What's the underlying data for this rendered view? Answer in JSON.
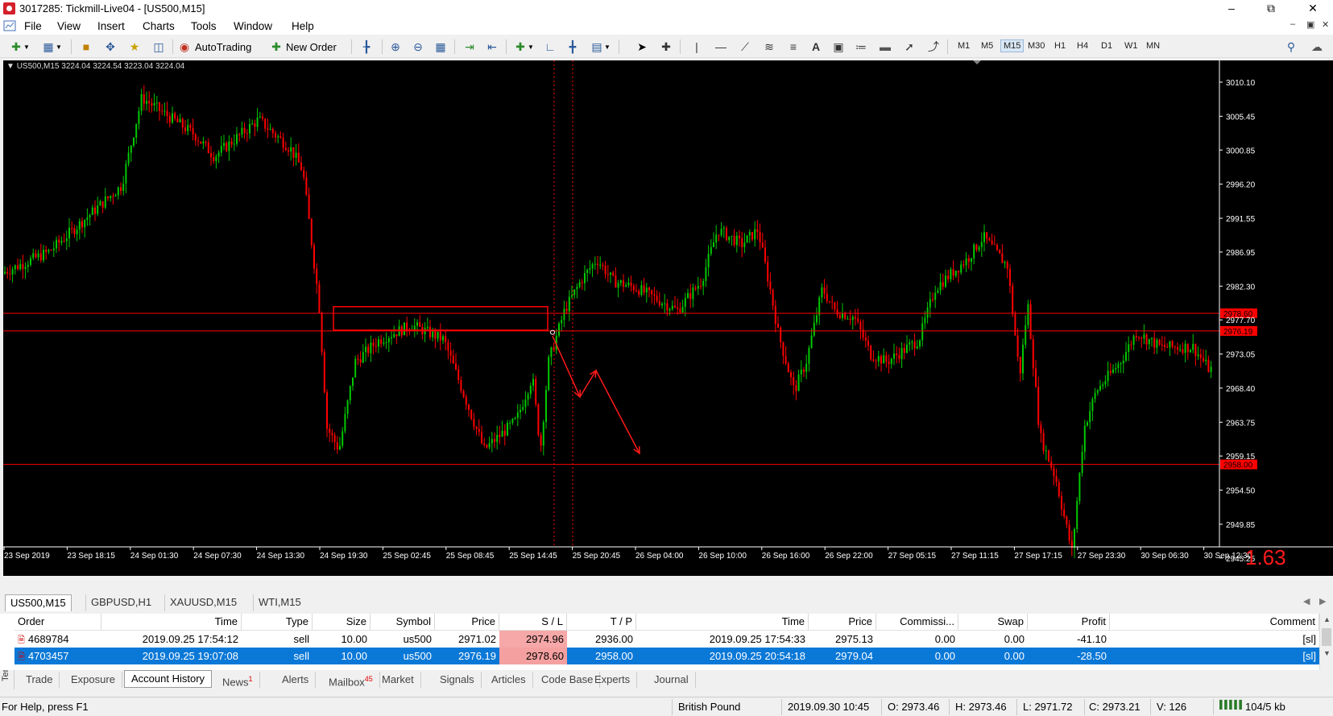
{
  "window": {
    "title": "3017285: Tickmill-Live04 - [US500,M15]"
  },
  "menu": [
    "File",
    "View",
    "Insert",
    "Charts",
    "Tools",
    "Window",
    "Help"
  ],
  "toolbar": {
    "autotrading": "AutoTrading",
    "new_order": "New Order",
    "timeframes": [
      "M1",
      "M5",
      "M15",
      "M30",
      "H1",
      "H4",
      "D1",
      "W1",
      "MN"
    ],
    "active_timeframe": "M15"
  },
  "chart": {
    "info": "US500,M15  3224.04 3224.54 3223.04 3224.04",
    "overlay_value": "1.63",
    "colors": {
      "background": "#000000",
      "up": "#00c800",
      "down": "#ff0000",
      "lines": "#ff0000"
    },
    "y_ticks": [
      "3010.10",
      "3005.45",
      "3000.85",
      "2996.20",
      "2991.55",
      "2986.95",
      "2982.30",
      "2977.70",
      "2973.05",
      "2968.40",
      "2963.75",
      "2959.15",
      "2954.50",
      "2949.85",
      "2945.25"
    ],
    "price_marks": [
      "2978.60",
      "2976.19",
      "2958.00"
    ],
    "x_ticks": [
      "23 Sep 2019",
      "23 Sep 18:15",
      "24 Sep 01:30",
      "24 Sep 07:30",
      "24 Sep 13:30",
      "24 Sep 19:30",
      "25 Sep 02:45",
      "25 Sep 08:45",
      "25 Sep 14:45",
      "25 Sep 20:45",
      "26 Sep 04:00",
      "26 Sep 10:00",
      "26 Sep 16:00",
      "26 Sep 22:00",
      "27 Sep 05:15",
      "27 Sep 11:15",
      "27 Sep 17:15",
      "27 Sep 23:30",
      "30 Sep 06:30",
      "30 Sep 12:30"
    ]
  },
  "chart_tabs": [
    "US500,M15",
    "GBPUSD,H1",
    "XAUUSD,M15",
    "WTI,M15"
  ],
  "terminal": {
    "side_label": "Terminal",
    "columns": [
      "Order",
      "Time",
      "Type",
      "Size",
      "Symbol",
      "Price",
      "S / L",
      "T / P",
      "Time",
      "Price",
      "Commissi...",
      "Swap",
      "Profit",
      "Comment"
    ],
    "rows": [
      [
        "4689784",
        "2019.09.25 17:54:12",
        "sell",
        "10.00",
        "us500",
        "2971.02",
        "2974.96",
        "2936.00",
        "2019.09.25 17:54:33",
        "2975.13",
        "0.00",
        "0.00",
        "-41.10",
        "[sl]"
      ],
      [
        "4703457",
        "2019.09.25 19:07:08",
        "sell",
        "10.00",
        "us500",
        "2976.19",
        "2978.60",
        "2958.00",
        "2019.09.25 20:54:18",
        "2979.04",
        "0.00",
        "0.00",
        "-28.50",
        "[sl]"
      ]
    ],
    "tabs": [
      "Trade",
      "Exposure",
      "Account History",
      "News",
      "Alerts",
      "Mailbox",
      "Market",
      "Signals",
      "Articles",
      "Code Base",
      "Experts",
      "Journal"
    ],
    "badges": {
      "news": "1",
      "mailbox": "45"
    },
    "active_tab": "Account History"
  },
  "status": {
    "help": "For Help, press F1",
    "profile": "British Pound",
    "datetime": "2019.09.30 10:45",
    "open": "O: 2973.46",
    "high": "H: 2973.46",
    "low": "L: 2971.72",
    "close": "C: 2973.21",
    "volume": "V: 126",
    "traffic": "104/5 kb"
  }
}
